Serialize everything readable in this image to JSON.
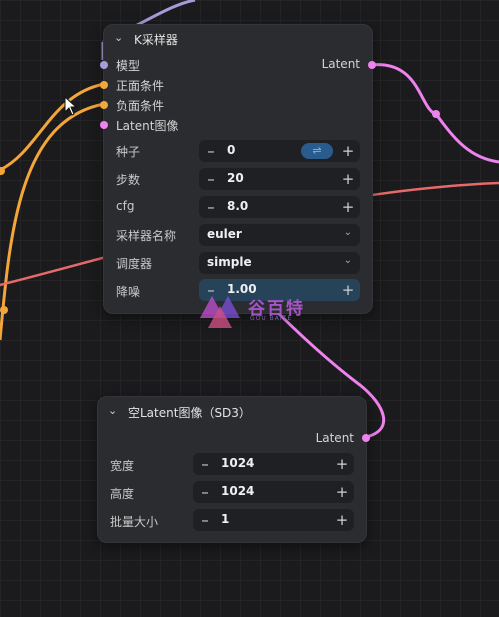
{
  "ksampler": {
    "title": "K采样器",
    "inputs": [
      {
        "label": "模型",
        "color": "#a99bd9"
      },
      {
        "label": "正面条件",
        "color": "#f5a63a"
      },
      {
        "label": "负面条件",
        "color": "#f5a63a"
      },
      {
        "label": "Latent图像",
        "color": "#ee82ee"
      }
    ],
    "output": {
      "label": "Latent",
      "color": "#ee82ee"
    },
    "widgets": {
      "seed": {
        "label": "种子",
        "value": "0"
      },
      "steps": {
        "label": "步数",
        "value": "20"
      },
      "cfg": {
        "label": "cfg",
        "value": "8.0"
      },
      "sampler": {
        "label": "采样器名称",
        "value": "euler"
      },
      "scheduler": {
        "label": "调度器",
        "value": "simple"
      },
      "denoise": {
        "label": "降噪",
        "value": "1.00"
      }
    }
  },
  "empty_latent": {
    "title": "空Latent图像（SD3）",
    "output": {
      "label": "Latent",
      "color": "#ee82ee"
    },
    "widgets": {
      "width": {
        "label": "宽度",
        "value": "1024"
      },
      "height": {
        "label": "高度",
        "value": "1024"
      },
      "batch": {
        "label": "批量大小",
        "value": "1"
      }
    }
  },
  "icons": {
    "collapse": "chevron-down-icon",
    "decrement": "minus-icon",
    "increment": "plus-icon",
    "randomize": "shuffle-icon",
    "dropdown": "chevron-down-icon",
    "cursor": "mouse-pointer-icon"
  },
  "watermark": {
    "text": "谷百特",
    "sub": "GOU BAITE"
  },
  "colors": {
    "model_wire": "#a99bd9",
    "conditioning_wire": "#f5a63a",
    "latent_wire": "#ee82ee",
    "red_wire": "#e56a6a",
    "seed_randomize_bg": "#2a5b8d"
  }
}
